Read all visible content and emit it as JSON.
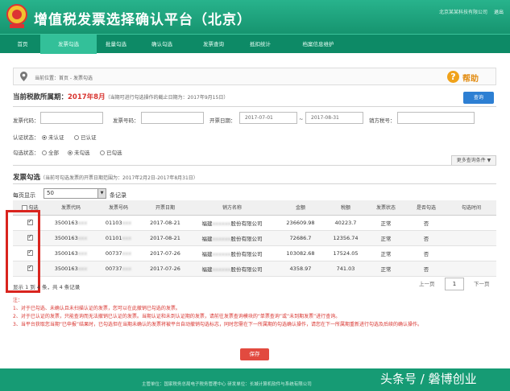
{
  "header": {
    "title": "增值税发票选择确认平台（北京）",
    "user_info": "北京某某科技有限公司",
    "logout_label": "退出"
  },
  "nav": {
    "items": [
      {
        "label": "首页"
      },
      {
        "label": "发票勾选"
      },
      {
        "label": "批量勾选"
      },
      {
        "label": "确认勾选"
      },
      {
        "label": "发票查询"
      },
      {
        "label": "抵扣统计"
      },
      {
        "label": "档案信息维护"
      }
    ],
    "active_index": 1
  },
  "breadcrumb": {
    "text": "当前位置：首页 - 发票勾选",
    "help_label": "帮助"
  },
  "period": {
    "label": "当前税款所属期：",
    "value": "2017年8月",
    "note": "（当期可进行勾选操作的截止日期为：2017年9月15日）",
    "query_label": "查询"
  },
  "filters": {
    "invoice_code_label": "发票代码：",
    "invoice_code_value": "",
    "invoice_number_label": "发票号码：",
    "invoice_number_value": "",
    "issue_date_label": "开票日期：",
    "date_from": "2017-07-01",
    "date_sep": "~",
    "date_to": "2017-08-31",
    "seller_tax_label": "销方税号：",
    "seller_tax_value": "",
    "auth_status_label": "认证状态：",
    "auth_options": [
      "未认证",
      "已认证"
    ],
    "auth_selected": 0,
    "check_status_label": "勾选状态：",
    "check_options": [
      "全部",
      "未勾选",
      "已勾选"
    ],
    "check_selected": 1,
    "more_filters_label": "更多查询条件 ▼"
  },
  "section": {
    "title": "发票勾选",
    "note": "（当前可勾选发票的开票日期范围为：2017年2月2日-2017年8月31日）",
    "per_page_label": "每页显示",
    "per_page_value": "50",
    "per_page_unit": "条记录"
  },
  "table": {
    "columns": [
      "勾选",
      "发票代码",
      "发票号码",
      "开票日期",
      "销方名称",
      "金额",
      "税额",
      "发票状态",
      "是否勾选",
      "勾选时间"
    ],
    "rows": [
      {
        "checked": true,
        "code": "3500163",
        "code_hidden": "xxx",
        "number": "01103",
        "number_hidden": "xxx",
        "date": "2017-08-21",
        "seller_prefix": "福建",
        "seller_hidden": "xxxxxx",
        "seller_suffix": "股份有限公司",
        "amount": "236609.98",
        "tax": "40223.7",
        "status": "正常",
        "selected": "否",
        "time": ""
      },
      {
        "checked": true,
        "code": "3500163",
        "code_hidden": "xxx",
        "number": "01101",
        "number_hidden": "xxx",
        "date": "2017-08-21",
        "seller_prefix": "福建",
        "seller_hidden": "xxxxxx",
        "seller_suffix": "股份有限公司",
        "amount": "72686.7",
        "tax": "12356.74",
        "status": "正常",
        "selected": "否",
        "time": ""
      },
      {
        "checked": true,
        "code": "3500163",
        "code_hidden": "xxx",
        "number": "00737",
        "number_hidden": "xxx",
        "date": "2017-07-26",
        "seller_prefix": "福建",
        "seller_hidden": "xxxxxx",
        "seller_suffix": "股份有限公司",
        "amount": "103082.68",
        "tax": "17524.05",
        "status": "正常",
        "selected": "否",
        "time": ""
      },
      {
        "checked": true,
        "code": "3500163",
        "code_hidden": "xxx",
        "number": "00737",
        "number_hidden": "xxx",
        "date": "2017-07-26",
        "seller_prefix": "福建",
        "seller_hidden": "xxxxxx",
        "seller_suffix": "股份有限公司",
        "amount": "4358.97",
        "tax": "741.03",
        "status": "正常",
        "selected": "否",
        "time": ""
      }
    ],
    "summary": "显示 1 到 4 条，共 4 条记录"
  },
  "pager": {
    "prev_label": "上一页",
    "current_page": "1",
    "next_label": "下一页"
  },
  "notes": {
    "title": "注：",
    "lines": [
      "1、对于已勾选、未确认且未扫描认证的发票，您可以在此撤销已勾选的发票。",
      "2、对于已认证的发票，只能查询而无法撤销已认证的发票。当期认证和未到认证期的发票，请前往发票查询模块的“单票查询”或“未到期发票”进行查询。",
      "3、当平台获取您当期“已申报”结果时，已勾选但在当期未确认的发票将被平台自动撤销勾选标志，同时您需在下一所属期的勾选确认操作，请您在下一所属期重新进行勾选及后续的确认操作。"
    ]
  },
  "actions": {
    "save_label": "保存"
  },
  "footer": {
    "text": "主管单位：国家税务总局电子税务管理中心    研发单位：长城计算机软件与系统有限公司",
    "watermark": "头条号 / 磐博创业"
  },
  "colors": {
    "brand_green": "#16946f",
    "nav_active": "#33c099",
    "accent_red": "#d8342f",
    "query_blue": "#2d7fd3",
    "help_orange": "#f0a21a"
  }
}
